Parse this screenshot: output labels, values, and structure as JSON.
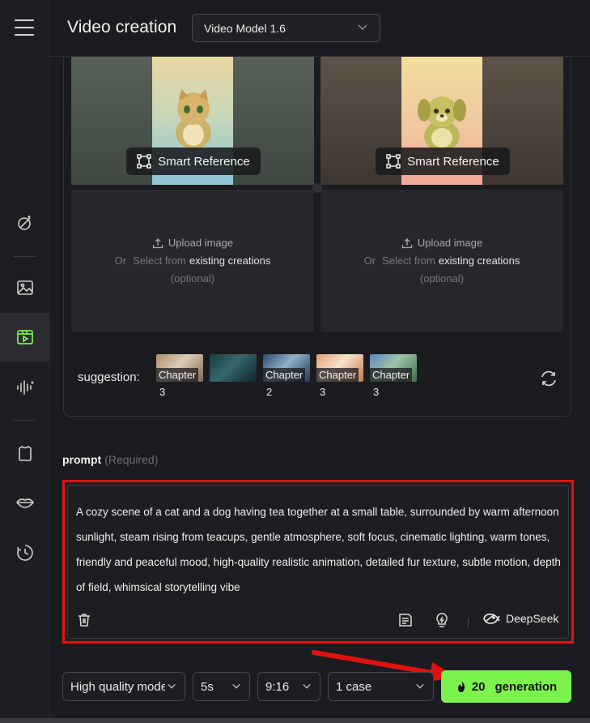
{
  "header": {
    "title": "Video creation",
    "model_select": "Video Model 1.6"
  },
  "sidebar": {
    "items": [
      {
        "icon": "magic-wand-icon"
      },
      {
        "icon": "image-icon"
      },
      {
        "icon": "video-icon",
        "active": true
      },
      {
        "icon": "audio-wave-icon"
      },
      {
        "icon": "shirt-icon"
      },
      {
        "icon": "lips-icon"
      },
      {
        "icon": "history-icon"
      }
    ],
    "accent": "#7cf24f"
  },
  "reference": {
    "smart_reference_label": "Smart Reference",
    "upload_label": "Upload image",
    "or_label": "Or",
    "select_from_label": "Select from",
    "existing_creations_label": "existing creations",
    "optional_label": "(optional)"
  },
  "suggestion": {
    "label": "suggestion:",
    "items": [
      {
        "tag": "Chapter",
        "num": "3"
      },
      {
        "tag": "",
        "num": ""
      },
      {
        "tag": "Chapter",
        "num": "2"
      },
      {
        "tag": "Chapter",
        "num": "3"
      },
      {
        "tag": "Chapter",
        "num": "3"
      }
    ]
  },
  "prompt": {
    "label": "prompt",
    "required": "(Required)",
    "text": "A cozy scene of a cat and a dog having tea together at a small table, surrounded by warm afternoon sunlight, steam rising from teacups, gentle atmosphere, soft focus, cinematic lighting, warm tones, friendly and peaceful mood, high-quality realistic animation, detailed fur texture, subtle motion, depth of field, whimsical storytelling vibe",
    "deepseek_label": "DeepSeek",
    "highlight_color": "#e01111"
  },
  "controls": {
    "quality": "High quality mode",
    "duration": "5s",
    "ratio": "9:16",
    "cases": "1 case",
    "generate_count": "20",
    "generate_label": "generation"
  }
}
